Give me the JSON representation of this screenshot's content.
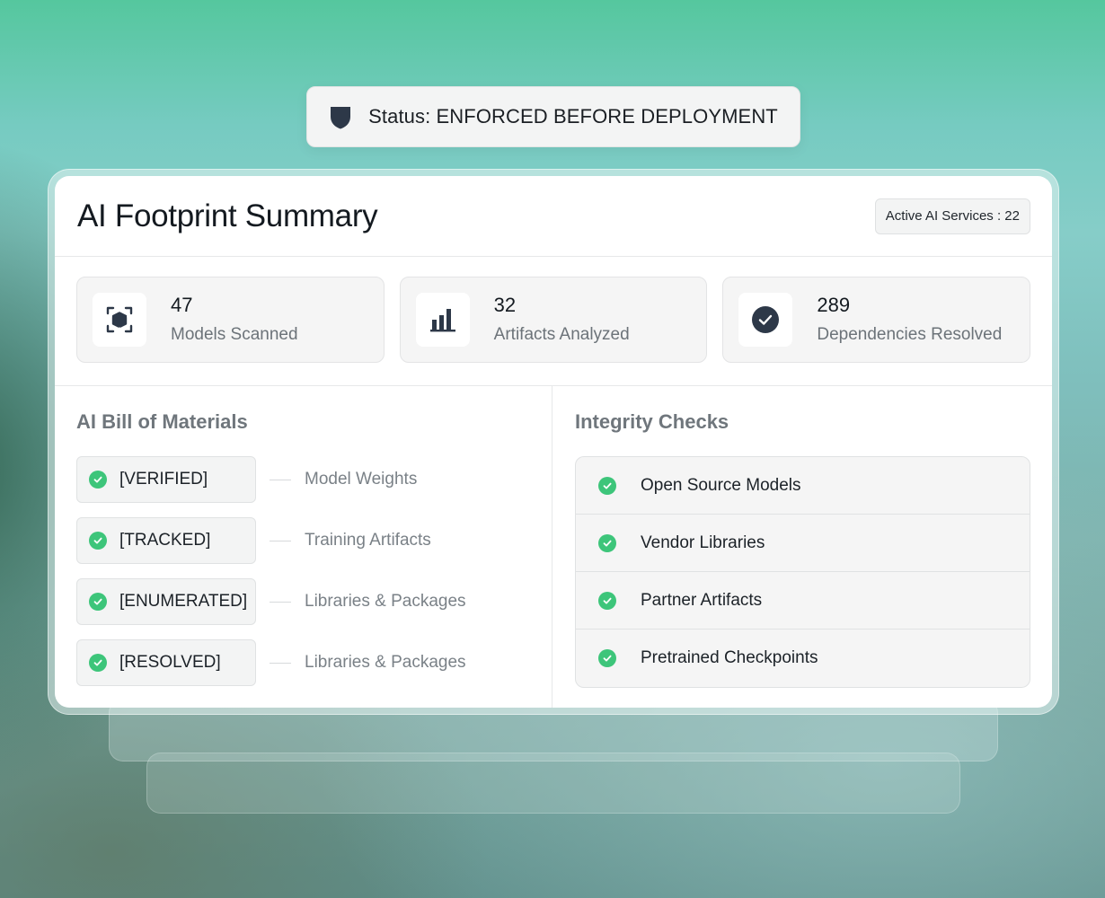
{
  "status": {
    "text": "Status: ENFORCED BEFORE DEPLOYMENT",
    "icon": "shield-icon"
  },
  "summary": {
    "title": "AI Footprint Summary",
    "active_services": "Active AI Services : 22"
  },
  "stats": [
    {
      "value": "47",
      "label": "Models Scanned",
      "icon": "cube-scan-icon"
    },
    {
      "value": "32",
      "label": "Artifacts Analyzed",
      "icon": "bar-chart-icon"
    },
    {
      "value": "289",
      "label": "Dependencies Resolved",
      "icon": "check-circle-icon"
    }
  ],
  "bom": {
    "title": "AI Bill of Materials",
    "items": [
      {
        "tag": "[VERIFIED]",
        "label": "Model Weights"
      },
      {
        "tag": "[TRACKED]",
        "label": "Training Artifacts"
      },
      {
        "tag": "[ENUMERATED]",
        "label": "Libraries & Packages"
      },
      {
        "tag": "[RESOLVED]",
        "label": "Libraries & Packages"
      }
    ]
  },
  "integrity": {
    "title": "Integrity Checks",
    "items": [
      {
        "label": "Open Source Models"
      },
      {
        "label": "Vendor Libraries"
      },
      {
        "label": "Partner Artifacts"
      },
      {
        "label": "Pretrained Checkpoints"
      }
    ]
  },
  "colors": {
    "check_green": "#3dc57a",
    "icon_dark": "#2d3848"
  }
}
